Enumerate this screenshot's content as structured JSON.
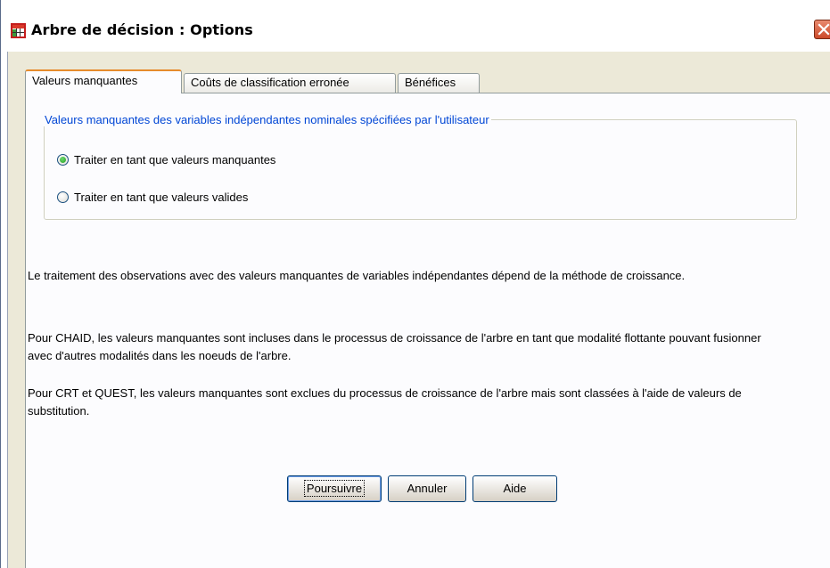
{
  "window": {
    "title": "Arbre de décision : Options"
  },
  "tabs": [
    {
      "label": "Valeurs manquantes",
      "active": true
    },
    {
      "label": "Coûts de classification erronée",
      "active": false
    },
    {
      "label": "Bénéfices",
      "active": false
    }
  ],
  "group": {
    "legend": "Valeurs manquantes des variables indépendantes nominales spécifiées par l'utilisateur",
    "options": [
      {
        "label": "Traiter en tant que valeurs manquantes",
        "checked": true
      },
      {
        "label": "Traiter en tant que valeurs valides",
        "checked": false
      }
    ]
  },
  "description": [
    "Le traitement des observations avec des valeurs manquantes de variables indépendantes dépend de la méthode de croissance.",
    "Pour CHAID, les valeurs manquantes sont incluses dans le processus de croissance de l'arbre en tant que modalité flottante pouvant fusionner avec d'autres modalités dans les noeuds de l'arbre.",
    "Pour CRT et QUEST, les valeurs manquantes sont exclues du processus de croissance de l'arbre mais sont classées à l'aide de valeurs de substitution."
  ],
  "buttons": {
    "continue": "Poursuivre",
    "cancel": "Annuler",
    "help": "Aide"
  },
  "colors": {
    "legend": "#0046d5",
    "active_tab_accent": "#e68b2c",
    "dialog_bg": "#ece9d8"
  },
  "icons": {
    "app": "tree-grid-icon",
    "close": "close-icon"
  }
}
